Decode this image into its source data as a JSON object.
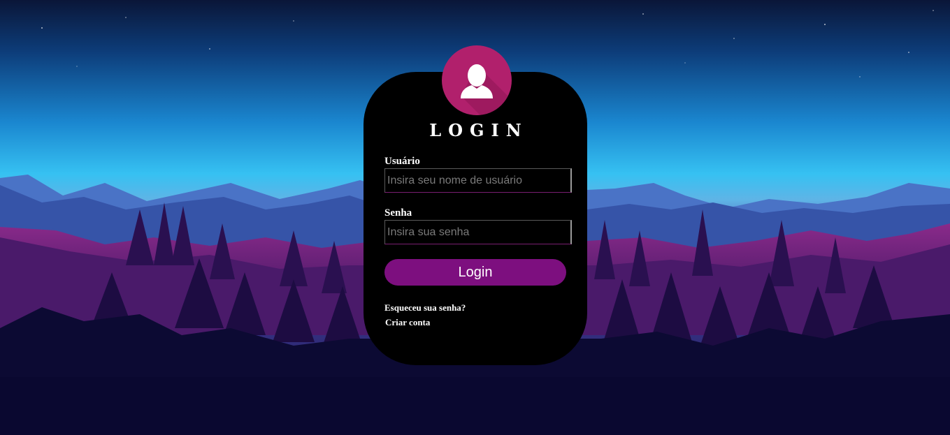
{
  "login": {
    "title": "LOGIN",
    "username_label": "Usuário",
    "username_placeholder": "Insira seu nome de usuário",
    "password_label": "Senha",
    "password_placeholder": "Insira sua senha",
    "submit_label": "Login",
    "forgot_link": "Esqueceu sua senha?",
    "create_link": "Criar conta"
  },
  "icons": {
    "avatar": "user-silhouette-icon"
  },
  "colors": {
    "card": "#000000",
    "avatar": "#b1206c",
    "button": "#7d0f7f",
    "sky_top": "#0a1a45",
    "sky_horizon": "#2ab6f0",
    "forest": "#0c0a33"
  }
}
